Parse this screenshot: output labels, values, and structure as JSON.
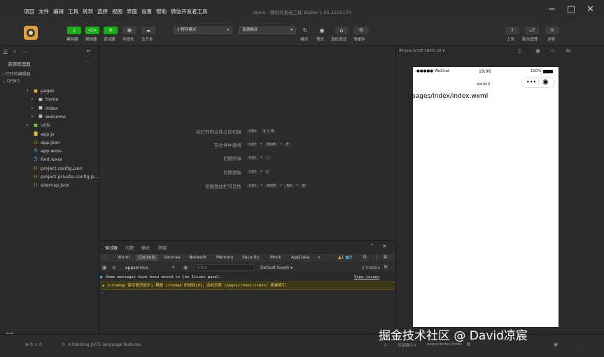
{
  "titlebar": {
    "menu": [
      "项目",
      "文件",
      "编辑",
      "工具",
      "转到",
      "选择",
      "视图",
      "界面",
      "设置",
      "帮助",
      "微信开发者工具"
    ],
    "app_title": "demo - 微信开发者工具 Stable 1.05.2105170",
    "minimize": "−",
    "maximize": "□",
    "close": "✕"
  },
  "toolbar": {
    "left_buttons": [
      {
        "label": "模拟器",
        "glyph": "▯",
        "color": "#1aad19"
      },
      {
        "label": "编辑器",
        "glyph": "</>",
        "color": "#1aad19"
      },
      {
        "label": "调试器",
        "glyph": "⚒",
        "color": "#1aad19"
      },
      {
        "label": "可视化",
        "glyph": "▤",
        "color": "#3d3d3d"
      },
      {
        "label": "云开发",
        "glyph": "☁",
        "color": "#3d3d3d"
      }
    ],
    "mode_select": "小程序模式",
    "compile_select": "普通编译",
    "mid_buttons": [
      {
        "label": "编译",
        "glyph": "↻"
      },
      {
        "label": "预览",
        "glyph": "◉"
      },
      {
        "label": "真机调试",
        "glyph": "⌂"
      },
      {
        "label": "清缓存",
        "glyph": "⧉"
      }
    ],
    "right_buttons": [
      {
        "label": "上传",
        "glyph": "⇪"
      },
      {
        "label": "版本管理",
        "glyph": "⎇"
      },
      {
        "label": "详情",
        "glyph": "≡"
      }
    ]
  },
  "sidebar": {
    "title": "资源管理器",
    "more": "···",
    "sections": [
      "打开的编辑器",
      "DEMO"
    ],
    "tree": [
      {
        "label": "pages",
        "depth": 1,
        "arrow": "▾",
        "icon": "folder",
        "color": "#e8a33d"
      },
      {
        "label": "home",
        "depth": 2,
        "arrow": "▸",
        "icon": "folder",
        "color": "#c0c0c0"
      },
      {
        "label": "index",
        "depth": 2,
        "arrow": "▸",
        "icon": "folder",
        "color": "#c0c0c0"
      },
      {
        "label": "welcome",
        "depth": 2,
        "arrow": "▸",
        "icon": "folder",
        "color": "#c0c0c0"
      },
      {
        "label": "utils",
        "depth": 1,
        "arrow": "▸",
        "icon": "folder",
        "color": "#8bc34a"
      },
      {
        "label": "app.js",
        "depth": 1,
        "arrow": "",
        "icon": "js",
        "color": "#e9c03a"
      },
      {
        "label": "app.json",
        "depth": 1,
        "arrow": "",
        "icon": "json",
        "color": "#e8a33d"
      },
      {
        "label": "app.wxss",
        "depth": 1,
        "arrow": "",
        "icon": "wxss",
        "color": "#4aa3df"
      },
      {
        "label": "font.wxss",
        "depth": 1,
        "arrow": "",
        "icon": "wxss",
        "color": "#4aa3df"
      },
      {
        "label": "project.config.json",
        "depth": 1,
        "arrow": "",
        "icon": "json",
        "color": "#e8a33d"
      },
      {
        "label": "project.private.config.js...",
        "depth": 1,
        "arrow": "",
        "icon": "json",
        "color": "#e8a33d"
      },
      {
        "label": "sitemap.json",
        "depth": 1,
        "arrow": "",
        "icon": "json",
        "color": "#e8a33d"
      }
    ],
    "outline": "大纲"
  },
  "editor": {
    "hints": [
      {
        "label": "在打开的文件之间切换",
        "keys": [
          "Ctrl",
          "1 ~ 9"
        ]
      },
      {
        "label": "在文件中查找",
        "keys": [
          "Ctrl",
          "+",
          "Shift",
          "+",
          "F"
        ]
      },
      {
        "label": "切换终端",
        "keys": [
          "Ctrl",
          "+",
          "`"
        ]
      },
      {
        "label": "切换面板",
        "keys": [
          "Ctrl",
          "+",
          "J"
        ]
      },
      {
        "label": "切换侧边栏可见性",
        "keys": [
          "Ctrl",
          "+",
          "Shift",
          "+",
          "Alt",
          "+",
          "B"
        ]
      }
    ]
  },
  "debug": {
    "tabs": [
      "调试器",
      "问题",
      "输出",
      "终端"
    ],
    "devtools_tabs": [
      "Wxml",
      "Console",
      "Sources",
      "Network",
      "Memory",
      "Security",
      "Mock",
      "AppData",
      "»"
    ],
    "active_tab": "Console",
    "warnings": "1",
    "infos": "3",
    "context": "appservice",
    "filter_placeholder": "Filter",
    "levels": "Default levels ▾",
    "hidden": "2 hidden",
    "message_info": "Some messages have been moved to the Issues panel.",
    "view_issues": "View issues",
    "message_warn": "[sitemap 索引情况提示] 根据 sitemap 的规则[0]，当前页面 [pages/index/index] 将被索引",
    "prompt": "›"
  },
  "simulator": {
    "device": "iPhone 6/7/8 100% 16 ▾",
    "carrier": "●●●●● WeChat",
    "time": "19:06",
    "battery": "100%",
    "nav_title": "weixin",
    "page_path": "pages/index/index.wxml"
  },
  "statusbar": {
    "errors": "⊗ 0 ⚠ 0",
    "message": "Initializing JS/TS language features",
    "page_path_label": "页面路径 ▾",
    "page_path": "pages/index/index"
  },
  "watermark": "掘金技术社区 @ David凉宸",
  "colors": {
    "accent": "#1aad19",
    "warn_bg": "#3b3616",
    "warn_text": "#f0d36a"
  }
}
